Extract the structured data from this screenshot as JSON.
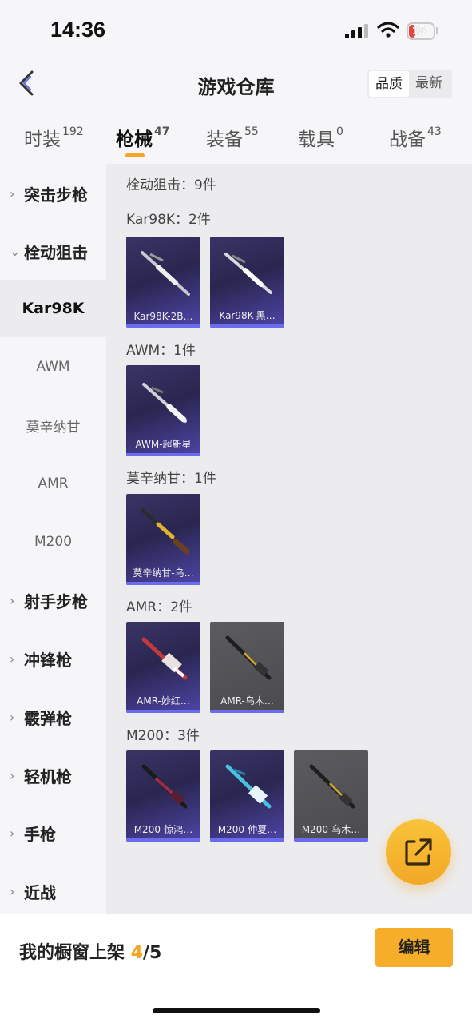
{
  "status_bar": {
    "time": "14:36",
    "battery": "15"
  },
  "header": {
    "title": "游戏仓库",
    "sort_options": [
      "品质",
      "最新"
    ]
  },
  "tabs": [
    {
      "label": "时装",
      "count": "192"
    },
    {
      "label": "枪械",
      "count": "47"
    },
    {
      "label": "装备",
      "count": "55"
    },
    {
      "label": "载具",
      "count": "0"
    },
    {
      "label": "战备",
      "count": "43"
    }
  ],
  "sidebar": {
    "items": [
      {
        "label": "突击步枪",
        "chev": "›"
      },
      {
        "label": "栓动狙击",
        "chev": "⌄"
      },
      {
        "label": "Kar98K"
      },
      {
        "label": "AWM"
      },
      {
        "label": "莫辛纳甘"
      },
      {
        "label": "AMR"
      },
      {
        "label": "M200"
      },
      {
        "label": "射手步枪",
        "chev": "›"
      },
      {
        "label": "冲锋枪",
        "chev": "›"
      },
      {
        "label": "霰弹枪",
        "chev": "›"
      },
      {
        "label": "轻机枪",
        "chev": "›"
      },
      {
        "label": "手枪",
        "chev": "›"
      },
      {
        "label": "近战",
        "chev": "›"
      }
    ]
  },
  "content": {
    "summary": "栓动狙击：9件",
    "groups": [
      {
        "header": "Kar98K：2件",
        "items": [
          {
            "name": "Kar98K-2B…",
            "style": "purple"
          },
          {
            "name": "Kar98K-黑…",
            "style": "purple"
          }
        ]
      },
      {
        "header": "AWM：1件",
        "items": [
          {
            "name": "AWM-超新星",
            "style": "purple"
          }
        ]
      },
      {
        "header": "莫辛纳甘：1件",
        "items": [
          {
            "name": "莫辛纳甘-乌…",
            "style": "purple"
          }
        ]
      },
      {
        "header": "AMR：2件",
        "items": [
          {
            "name": "AMR-妙红…",
            "style": "purple"
          },
          {
            "name": "AMR-乌木…",
            "style": "grey"
          }
        ]
      },
      {
        "header": "M200：3件",
        "items": [
          {
            "name": "M200-惊鸿…",
            "style": "purple"
          },
          {
            "name": "M200-仲夏…",
            "style": "purple"
          },
          {
            "name": "M200-乌木…",
            "style": "grey"
          }
        ]
      }
    ]
  },
  "footer": {
    "shelf_label": "我的橱窗上架",
    "shelf_count": "4",
    "shelf_total": "/5",
    "edit_label": "编辑"
  },
  "colors": {
    "accent": "#f5a623",
    "item_purple": "#3a3466",
    "item_grey": "#55555a",
    "item_bar": "#6a6cf0"
  }
}
